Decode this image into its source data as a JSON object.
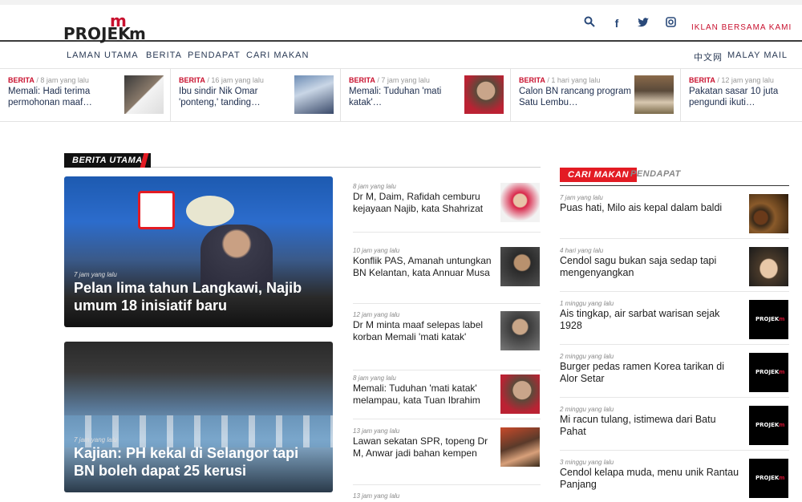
{
  "brand": {
    "logo_text": "PROJEK",
    "logo_m": "m"
  },
  "header": {
    "iklan": "IKLAN BERSAMA KAMI",
    "icons": [
      "search-icon",
      "facebook-icon",
      "twitter-icon",
      "instagram-icon"
    ]
  },
  "nav": {
    "items": [
      "LAMAN UTAMA",
      "BERITA",
      "PENDAPAT",
      "CARI MAKAN"
    ],
    "right": [
      "中文网",
      "MALAY MAIL"
    ]
  },
  "ticker": [
    {
      "cat": "BERITA",
      "time": "/ 8 jam yang lalu",
      "title": "Memali: Hadi terima permohonan maaf…"
    },
    {
      "cat": "BERITA",
      "time": "/ 16 jam yang lalu",
      "title": "Ibu sindir Nik Omar 'ponteng,' tanding…"
    },
    {
      "cat": "BERITA",
      "time": "/ 7 jam yang lalu",
      "title": "Memali: Tuduhan 'mati katak'…"
    },
    {
      "cat": "BERITA",
      "time": "/ 1 hari yang lalu",
      "title": "Calon BN rancang program Satu Lembu…"
    },
    {
      "cat": "BERITA",
      "time": "/ 12 jam yang lalu",
      "title": "Pakatan sasar 10 juta pengundi ikuti…"
    }
  ],
  "main": {
    "section": "BERITA UTAMA",
    "featured": [
      {
        "time": "7 jam yang lalu",
        "title": "Pelan lima tahun Langkawi, Najib umum 18 inisiatif baru"
      },
      {
        "time": "7 jam yang lalu",
        "title": "Kajian: PH kekal di Selangor tapi BN boleh dapat 25 kerusi"
      }
    ],
    "list": [
      {
        "time": "8 jam yang lalu",
        "title": "Dr M, Daim, Rafidah cemburu kejayaan Najib, kata Shahrizat"
      },
      {
        "time": "10 jam yang lalu",
        "title": "Konflik PAS, Amanah untungkan BN Kelantan, kata Annuar Musa"
      },
      {
        "time": "12 jam yang lalu",
        "title": "Dr M minta maaf selepas label korban Memali 'mati katak'"
      },
      {
        "time": "8 jam yang lalu",
        "title": "Memali: Tuduhan 'mati katak' melampau, kata Tuan Ibrahim"
      },
      {
        "time": "13 jam yang lalu",
        "title": "Lawan sekatan SPR, topeng Dr M, Anwar jadi bahan kempen"
      },
      {
        "time": "13 jam yang lalu",
        "title": ""
      }
    ]
  },
  "side": {
    "tab_active": "CARI MAKAN",
    "tab_other": "PENDAPAT",
    "list": [
      {
        "time": "7 jam yang lalu",
        "title": "Puas hati, Milo ais kepal dalam baldi"
      },
      {
        "time": "4 hari yang lalu",
        "title": "Cendol sagu bukan saja sedap tapi mengenyangkan"
      },
      {
        "time": "1 minggu yang lalu",
        "title": "Ais tingkap, air sarbat warisan sejak 1928"
      },
      {
        "time": "2 minggu yang lalu",
        "title": "Burger pedas ramen Korea tarikan di Alor Setar"
      },
      {
        "time": "2 minggu yang lalu",
        "title": "Mi racun tulang, istimewa dari Batu Pahat"
      },
      {
        "time": "3 minggu yang lalu",
        "title": "Cendol kelapa muda, menu unik Rantau Panjang"
      }
    ]
  },
  "colors": {
    "accent": "#c8102e",
    "red_label": "#e31b23",
    "nav_text": "#2a3a55"
  }
}
